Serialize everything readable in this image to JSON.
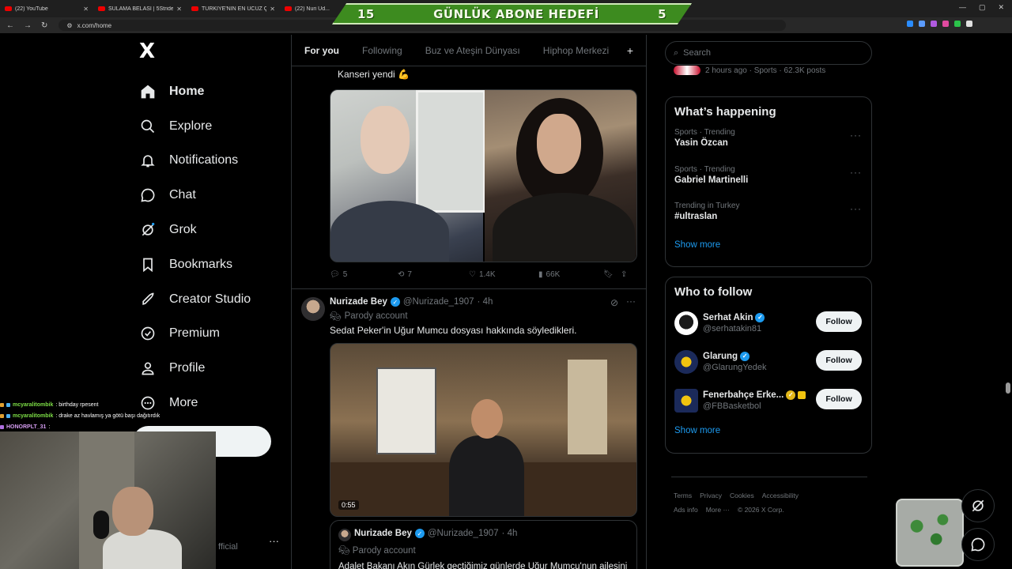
{
  "browser": {
    "tabs": [
      {
        "title": "(22) YouTube"
      },
      {
        "title": "SULAMA BELASI | 5Striders | M..."
      },
      {
        "title": "TÜRKİYE'NİN EN UCUZ ÇİĞ KÖ..."
      },
      {
        "title": "(22) Nuri Ud..."
      }
    ],
    "url": "x.com/home"
  },
  "banner": {
    "left_num": "15",
    "title": "GÜNLÜK ABONE HEDEFİ",
    "right_num": "5"
  },
  "nav": {
    "logo": "X",
    "items": [
      {
        "label": "Home",
        "icon": "home-icon"
      },
      {
        "label": "Explore",
        "icon": "search-icon"
      },
      {
        "label": "Notifications",
        "icon": "bell-icon"
      },
      {
        "label": "Chat",
        "icon": "chat-icon"
      },
      {
        "label": "Grok",
        "icon": "grok-icon"
      },
      {
        "label": "Bookmarks",
        "icon": "bookmark-icon"
      },
      {
        "label": "Creator Studio",
        "icon": "rocket-icon"
      },
      {
        "label": "Premium",
        "icon": "premium-icon"
      },
      {
        "label": "Profile",
        "icon": "profile-icon"
      },
      {
        "label": "More",
        "icon": "more-icon"
      }
    ]
  },
  "feed": {
    "tabs": [
      "For you",
      "Following",
      "Buz ve Ateşin Dünyası",
      "Hiphop Merkezi"
    ],
    "post1": {
      "text": "Kanseri yendi 💪",
      "replies": "5",
      "reposts": "7",
      "likes": "1.4K",
      "views": "66K"
    },
    "post2": {
      "name": "Nurizade Bey",
      "handle": "@Nurizade_1907",
      "time": "· 4h",
      "parody": "Parody account",
      "text": "Sedat Peker'in Uğur Mumcu dosyası hakkında söyledikleri.",
      "duration": "0:55",
      "quote": {
        "name": "Nurizade Bey",
        "handle": "@Nurizade_1907",
        "time": "· 4h",
        "parody": "Parody account",
        "text": "Adalet Bakanı Akın Gürlek geçtiğimiz günlerde Uğur Mumcu'nun ailesini"
      }
    }
  },
  "right": {
    "search_placeholder": "Search",
    "top_meta": "2 hours ago · Sports · 62.3K posts",
    "happening": {
      "title": "What’s happening",
      "trends": [
        {
          "category": "Sports · Trending",
          "name": "Yasin Özcan"
        },
        {
          "category": "Sports · Trending",
          "name": "Gabriel Martinelli"
        },
        {
          "category": "Trending in Turkey",
          "name": "#ultraslan"
        }
      ],
      "show_more": "Show more"
    },
    "who_to_follow": {
      "title": "Who to follow",
      "accounts": [
        {
          "name": "Serhat Akin",
          "handle": "@serhatakin81",
          "button": "Follow"
        },
        {
          "name": "Glarung",
          "handle": "@GlarungYedek",
          "button": "Follow"
        },
        {
          "name": "Fenerbahçe Erke...",
          "handle": "@FBBasketbol",
          "button": "Follow"
        }
      ],
      "show_more": "Show more"
    },
    "footer": {
      "links": [
        "Terms",
        "Privacy",
        "Cookies",
        "Accessibility",
        "Ads info",
        "More ···"
      ],
      "copyright": "© 2026 X Corp."
    }
  },
  "stream": {
    "chat": [
      {
        "user": "mcyaralitombik",
        "msg": ": birthday rpesent"
      },
      {
        "user": "mcyaralitombik",
        "msg": ": drake az havlamış ya götü başı dağıtırdık"
      },
      {
        "user": "HONORPLT_31",
        "msg": ":"
      }
    ],
    "official_text": "fficial"
  }
}
